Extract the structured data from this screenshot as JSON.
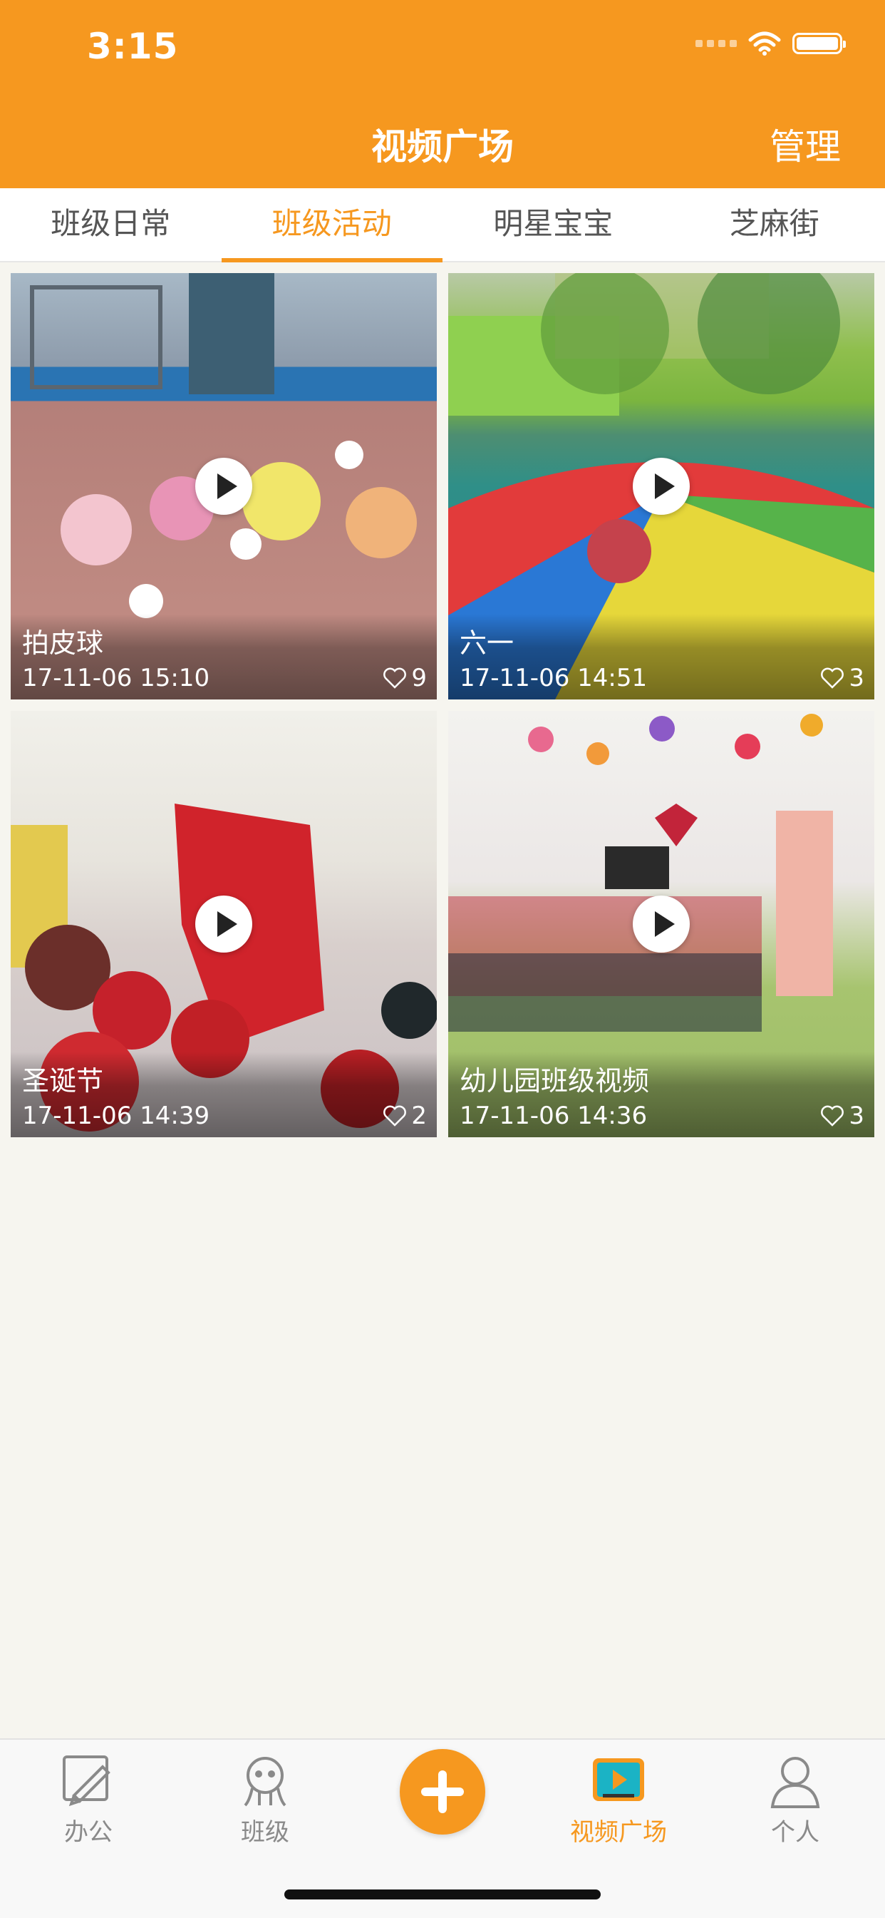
{
  "status_bar": {
    "time": "3:15"
  },
  "header": {
    "title": "视频广场",
    "manage_label": "管理",
    "accent_color": "#f6981f"
  },
  "tabs": [
    {
      "label": "班级日常",
      "active": false
    },
    {
      "label": "班级活动",
      "active": true
    },
    {
      "label": "明星宝宝",
      "active": false
    },
    {
      "label": "芝麻街",
      "active": false
    }
  ],
  "videos": [
    {
      "title": "拍皮球",
      "time": "17-11-06 15:10",
      "likes": "9"
    },
    {
      "title": "六一",
      "time": "17-11-06 14:51",
      "likes": "3"
    },
    {
      "title": "圣诞节",
      "time": "17-11-06 14:39",
      "likes": "2"
    },
    {
      "title": "幼儿园班级视频",
      "time": "17-11-06 14:36",
      "likes": "3"
    }
  ],
  "tabbar": {
    "items": [
      {
        "label": "办公",
        "icon": "pencil-icon",
        "active": false
      },
      {
        "label": "班级",
        "icon": "class-icon",
        "active": false
      },
      {
        "label": "",
        "icon": "add-icon",
        "active": false
      },
      {
        "label": "视频广场",
        "icon": "video-icon",
        "active": true
      },
      {
        "label": "个人",
        "icon": "person-icon",
        "active": false
      }
    ]
  }
}
